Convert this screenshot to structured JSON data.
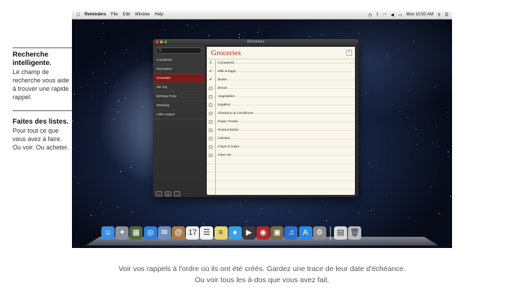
{
  "annotations": [
    {
      "title": "Recherche intelligente.",
      "body": "Le champ de recherche vous aide à trouver une rapide rappel."
    },
    {
      "title": "Faites des listes.",
      "body": "Pour tout ce que vous avez à faire. Ou voir. Ou acheter."
    }
  ],
  "menubar": {
    "app": "Reminders",
    "items": [
      "File",
      "Edit",
      "Window",
      "Help"
    ],
    "clock": "Mon 10:50 AM"
  },
  "window": {
    "title": "Reminders",
    "search_placeholder": "Q",
    "lists": [
      "Completed",
      "Reminders",
      "Groceries",
      "Ski Trip",
      "Birthday Party",
      "Wedding",
      "Little League"
    ],
    "selected_list": "Groceries",
    "bottom_icons": [
      "▭",
      "▤",
      "+"
    ],
    "heading": "Groceries",
    "add_label": "+",
    "completed_label": "Completed",
    "items": [
      {
        "text": "Milk & Eggs",
        "checked": true
      },
      {
        "text": "Butter",
        "checked": true
      },
      {
        "text": "Bread",
        "checked": false
      },
      {
        "text": "Vegetables",
        "checked": false
      },
      {
        "text": "Napkins",
        "checked": false
      },
      {
        "text": "Shampoo & Conditioner",
        "checked": false
      },
      {
        "text": "Paper Towels",
        "checked": false
      },
      {
        "text": "Peanut Butter",
        "checked": false
      },
      {
        "text": "Chicken",
        "checked": false
      },
      {
        "text": "Chips & Salsa",
        "checked": false
      },
      {
        "text": "Olive Oil",
        "checked": false
      }
    ]
  },
  "dock": [
    {
      "icon": "finder-icon",
      "color": "#3b8ee0",
      "glyph": "☺"
    },
    {
      "icon": "launchpad-icon",
      "color": "#8a8f99",
      "glyph": "✦"
    },
    {
      "icon": "mission-control-icon",
      "color": "#4d6b3a",
      "glyph": "▦"
    },
    {
      "icon": "safari-icon",
      "color": "#2f7fd8",
      "glyph": "◎"
    },
    {
      "icon": "mail-icon",
      "color": "#6f8fb8",
      "glyph": "✉"
    },
    {
      "icon": "contacts-icon",
      "color": "#a97b48",
      "glyph": "@"
    },
    {
      "icon": "calendar-icon",
      "color": "#f0f0f0",
      "glyph": "17"
    },
    {
      "icon": "reminders-icon",
      "color": "#f4f4f4",
      "glyph": "☰"
    },
    {
      "icon": "notes-icon",
      "color": "#e8d472",
      "glyph": "≡"
    },
    {
      "icon": "messages-icon",
      "color": "#3aa0e8",
      "glyph": "●"
    },
    {
      "icon": "facetime-icon",
      "color": "#3a3a3a",
      "glyph": "▶"
    },
    {
      "icon": "photo-booth-icon",
      "color": "#b02a2a",
      "glyph": "◉"
    },
    {
      "icon": "iphoto-icon",
      "color": "#7a6a4a",
      "glyph": "▣"
    },
    {
      "icon": "itunes-icon",
      "color": "#2d6fd0",
      "glyph": "♫"
    },
    {
      "icon": "app-store-icon",
      "color": "#2a8ae0",
      "glyph": "A"
    },
    {
      "icon": "system-preferences-icon",
      "color": "#8a8a8a",
      "glyph": "⚙"
    },
    {
      "icon": "documents-icon",
      "color": "#d8d8d8",
      "glyph": "▤"
    },
    {
      "icon": "trash-icon",
      "color": "#b8bcc2",
      "glyph": "🗑"
    }
  ],
  "caption": [
    "Voir vos rappels à l'ordre où ils ont été créés. Gardez une trace de leur date d'échéance.",
    "Ou voir tous les à-dos que vous avez fait."
  ]
}
